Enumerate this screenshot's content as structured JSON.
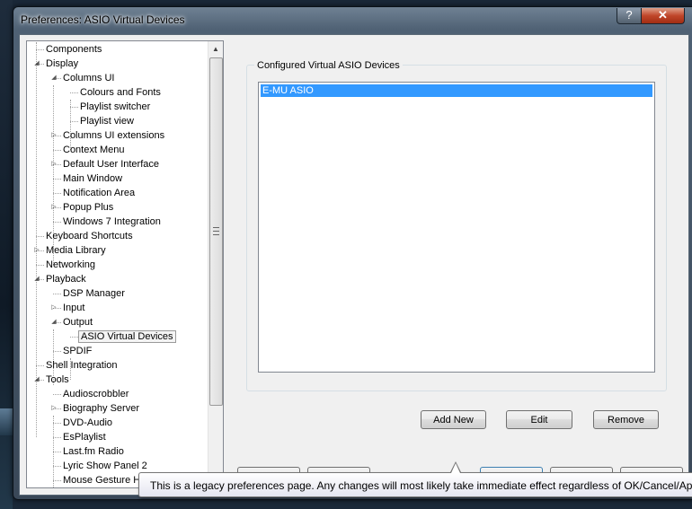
{
  "window": {
    "title": "Preferences: ASIO Virtual Devices",
    "help_label": "?",
    "close_label": "✕"
  },
  "tree": {
    "items": [
      {
        "label": "Components",
        "level": 0,
        "expander": "none"
      },
      {
        "label": "Display",
        "level": 0,
        "expander": "expanded"
      },
      {
        "label": "Columns UI",
        "level": 1,
        "expander": "expanded"
      },
      {
        "label": "Colours and Fonts",
        "level": 2,
        "expander": "none"
      },
      {
        "label": "Playlist switcher",
        "level": 2,
        "expander": "none"
      },
      {
        "label": "Playlist view",
        "level": 2,
        "expander": "none"
      },
      {
        "label": "Columns UI extensions",
        "level": 1,
        "expander": "collapsed"
      },
      {
        "label": "Context Menu",
        "level": 1,
        "expander": "none"
      },
      {
        "label": "Default User Interface",
        "level": 1,
        "expander": "collapsed"
      },
      {
        "label": "Main Window",
        "level": 1,
        "expander": "none"
      },
      {
        "label": "Notification Area",
        "level": 1,
        "expander": "none"
      },
      {
        "label": "Popup Plus",
        "level": 1,
        "expander": "collapsed"
      },
      {
        "label": "Windows 7 Integration",
        "level": 1,
        "expander": "none"
      },
      {
        "label": "Keyboard Shortcuts",
        "level": 0,
        "expander": "none"
      },
      {
        "label": "Media Library",
        "level": 0,
        "expander": "collapsed"
      },
      {
        "label": "Networking",
        "level": 0,
        "expander": "none"
      },
      {
        "label": "Playback",
        "level": 0,
        "expander": "expanded"
      },
      {
        "label": "DSP Manager",
        "level": 1,
        "expander": "none"
      },
      {
        "label": "Input",
        "level": 1,
        "expander": "collapsed"
      },
      {
        "label": "Output",
        "level": 1,
        "expander": "expanded"
      },
      {
        "label": "ASIO Virtual Devices",
        "level": 2,
        "expander": "none",
        "selected": true
      },
      {
        "label": "SPDIF",
        "level": 1,
        "expander": "none"
      },
      {
        "label": "Shell Integration",
        "level": 0,
        "expander": "none"
      },
      {
        "label": "Tools",
        "level": 0,
        "expander": "expanded"
      },
      {
        "label": "Audioscrobbler",
        "level": 1,
        "expander": "none"
      },
      {
        "label": "Biography Server",
        "level": 1,
        "expander": "collapsed"
      },
      {
        "label": "DVD-Audio",
        "level": 1,
        "expander": "none"
      },
      {
        "label": "EsPlaylist",
        "level": 1,
        "expander": "none"
      },
      {
        "label": "Last.fm Radio",
        "level": 1,
        "expander": "none"
      },
      {
        "label": "Lyric Show Panel 2",
        "level": 1,
        "expander": "none"
      },
      {
        "label": "Mouse Gesture H",
        "level": 1,
        "expander": "none"
      }
    ]
  },
  "panel": {
    "group_label": "Configured Virtual ASIO Devices",
    "devices": [
      "E-MU ASIO"
    ],
    "add_label": "Add New",
    "edit_label": "Edit",
    "remove_label": "Remove"
  },
  "tooltip": {
    "text": "This is a legacy preferences page. Any changes will most likely take immediate effect regardless of OK/Cancel/Apply."
  },
  "colors": {
    "selection": "#3399ff",
    "close_button": "#c0462a"
  }
}
